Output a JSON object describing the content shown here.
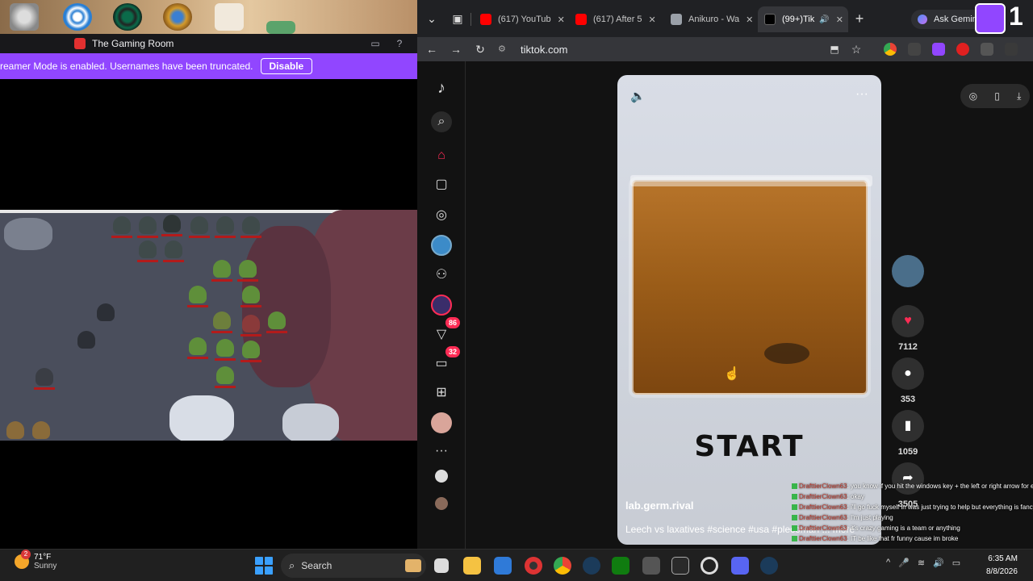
{
  "twitch": {
    "channel_title": "The Gaming Room",
    "banner_text": "reamer Mode is enabled. Usernames have been truncated.",
    "banner_button": "Disable"
  },
  "browser": {
    "tabs": [
      {
        "label": "(617) YouTub",
        "close": "✕"
      },
      {
        "label": "(617) After 5",
        "close": "✕"
      },
      {
        "label": "Anikuro - Wa",
        "close": "✕"
      },
      {
        "label": "(99+)Tik",
        "close": "✕"
      }
    ],
    "new_tab": "+",
    "gemini_label": "Ask Gemini",
    "url": "tiktok.com",
    "nav": {
      "back": "←",
      "forward": "→",
      "reload": "↻"
    }
  },
  "tiktok": {
    "nav_badges": {
      "inbox": "86",
      "messages": "32"
    },
    "video": {
      "overlay_text": "START",
      "username": "lab.germ.rival",
      "description": "Leech vs laxatives #science #usa #plecoman ... more"
    },
    "actions": {
      "likes": "7112",
      "comments": "353",
      "saves": "1059",
      "shares": "3505"
    }
  },
  "chat": [
    {
      "name": "DrafttierClown63",
      "text": ": you know if you hit the windows key + the left or right arrow for each window it'll automatically line it up for you side by side"
    },
    {
      "name": "DrafttierClown63",
      "text": ": okay"
    },
    {
      "name": "DrafttierClown63",
      "text": ": i'll go fuck myself in was just trying to help but everything is fancy a anime"
    },
    {
      "name": "DrafttierClown63",
      "text": ": I'm just playing"
    },
    {
      "name": "DrafttierClown63",
      "text": ": it's crazy gaming is a team or anything"
    },
    {
      "name": "DrafttierClown63",
      "text": ": IT be like that fr funny cause im broke"
    }
  ],
  "taskbar": {
    "weather_temp": "71°F",
    "weather_desc": "Sunny",
    "weather_badge": "2",
    "search_placeholder": "Search",
    "time": "6:35 AM",
    "date": "8/8/2026"
  },
  "twitch_corner": {
    "count": "1"
  }
}
